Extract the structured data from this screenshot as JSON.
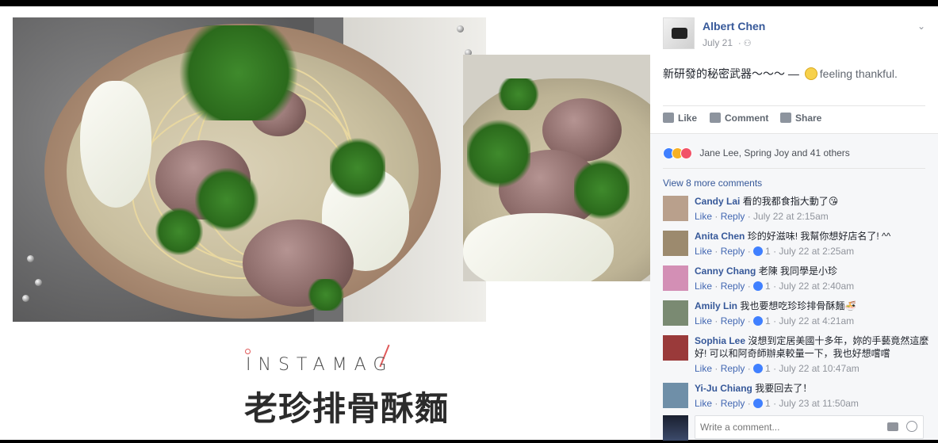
{
  "post": {
    "author": "Albert Chen",
    "date": "July 21",
    "audience_icon": "friends-icon",
    "message": "新研發的秘密武器〜〜〜",
    "separator": "—",
    "feeling": "feeling thankful."
  },
  "photo": {
    "brand": "INSTAMAG",
    "dish_name": "老珍排骨酥麵"
  },
  "actions": {
    "like": "Like",
    "comment": "Comment",
    "share": "Share"
  },
  "reactions": {
    "summary": "Jane Lee, Spring Joy and 41 others"
  },
  "comments_link": "View 8 more comments",
  "comments": [
    {
      "name": "Candy Lai",
      "text": "看的我都食指大動了😘",
      "like": "Like",
      "reply": "Reply",
      "likes": "",
      "time": "July 22 at 2:15am",
      "avatar_color": "#b9a08c"
    },
    {
      "name": "Anita Chen",
      "text": "珍的好滋味! 我幫你想好店名了! ^^",
      "like": "Like",
      "reply": "Reply",
      "likes": "1",
      "time": "July 22 at 2:25am",
      "avatar_color": "#9c8a6e"
    },
    {
      "name": "Canny Chang",
      "text": "老陳 我同學是小珍",
      "like": "Like",
      "reply": "Reply",
      "likes": "1",
      "time": "July 22 at 2:40am",
      "avatar_color": "#d38fb5"
    },
    {
      "name": "Amily Lin",
      "text": "我也要想吃珍珍排骨酥麵🍜",
      "like": "Like",
      "reply": "Reply",
      "likes": "1",
      "time": "July 22 at 4:21am",
      "avatar_color": "#7a8a72"
    },
    {
      "name": "Sophia Lee",
      "text": "沒想到定居美國十多年，妳的手藝竟然這麼好! 可以和阿奇師辦桌較量一下，我也好想嚐嚐",
      "like": "Like",
      "reply": "Reply",
      "likes": "1",
      "time": "July 22 at 10:47am",
      "avatar_color": "#9a3a3a"
    },
    {
      "name": "Yi-Ju Chiang",
      "text": "我要回去了！",
      "like": "Like",
      "reply": "Reply",
      "likes": "1",
      "time": "July 23 at 11:50am",
      "avatar_color": "#6f8fa8"
    }
  ],
  "composer": {
    "placeholder": "Write a comment..."
  }
}
